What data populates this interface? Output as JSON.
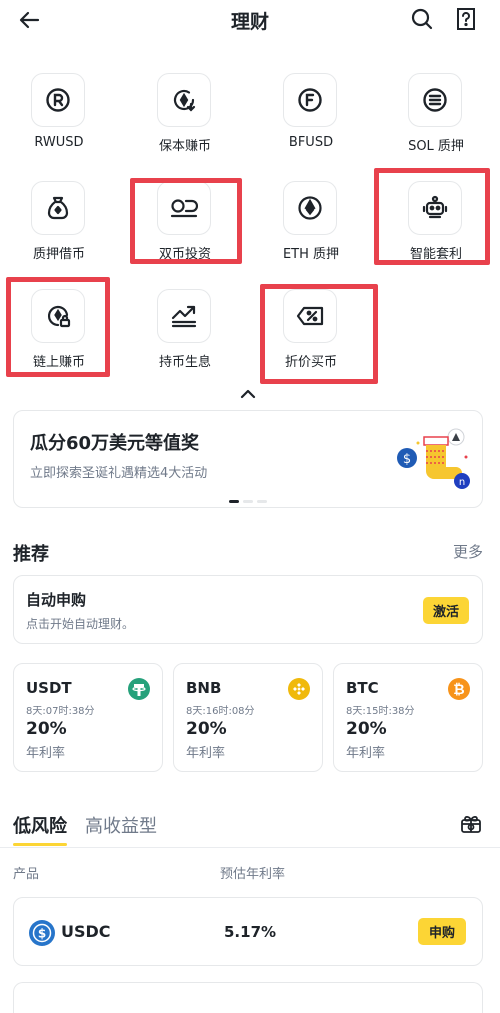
{
  "header": {
    "title": "理财"
  },
  "grid": [
    {
      "label": "RWUSD",
      "icon": "rwusd-icon"
    },
    {
      "label": "保本赚币",
      "icon": "principal-protected-icon"
    },
    {
      "label": "BFUSD",
      "icon": "bfusd-icon"
    },
    {
      "label": "SOL 质押",
      "icon": "sol-staking-icon"
    },
    {
      "label": "质押借币",
      "icon": "collateral-loan-icon"
    },
    {
      "label": "双币投资",
      "icon": "dual-investment-icon"
    },
    {
      "label": "ETH 质押",
      "icon": "eth-staking-icon"
    },
    {
      "label": "智能套利",
      "icon": "smart-arbitrage-icon"
    },
    {
      "label": "链上赚币",
      "icon": "onchain-earn-icon"
    },
    {
      "label": "持币生息",
      "icon": "hold-earn-icon"
    },
    {
      "label": "折价买币",
      "icon": "discount-buy-icon"
    }
  ],
  "promo": {
    "title": "瓜分60万美元等值奖",
    "subtitle": "立即探索圣诞礼遇精选4大活动"
  },
  "recommend": {
    "title": "推荐",
    "more": "更多",
    "auto_subscribe": {
      "title": "自动申购",
      "subtitle": "点击开始自动理财。",
      "button": "激活"
    },
    "cards": [
      {
        "coin": "USDT",
        "time": "8天:07时:38分",
        "rate": "20%",
        "rate_label": "年利率",
        "icon": "usdt-icon",
        "color": "#26a17b"
      },
      {
        "coin": "BNB",
        "time": "8天:16时:08分",
        "rate": "20%",
        "rate_label": "年利率",
        "icon": "bnb-icon",
        "color": "#f0b90b"
      },
      {
        "coin": "BTC",
        "time": "8天:15时:38分",
        "rate": "20%",
        "rate_label": "年利率",
        "icon": "btc-icon",
        "color": "#f7931a"
      }
    ]
  },
  "tabs": {
    "active": "低风险",
    "inactive": "高收益型"
  },
  "columns": {
    "product": "产品",
    "apr": "预估年利率"
  },
  "products": [
    {
      "name": "USDC",
      "rate": "5.17%",
      "button": "申购",
      "icon": "usdc-icon"
    }
  ],
  "colors": {
    "accent": "#fcd535",
    "highlight": "#e8414c",
    "text": "#1e2329",
    "muted": "#707a8a"
  }
}
